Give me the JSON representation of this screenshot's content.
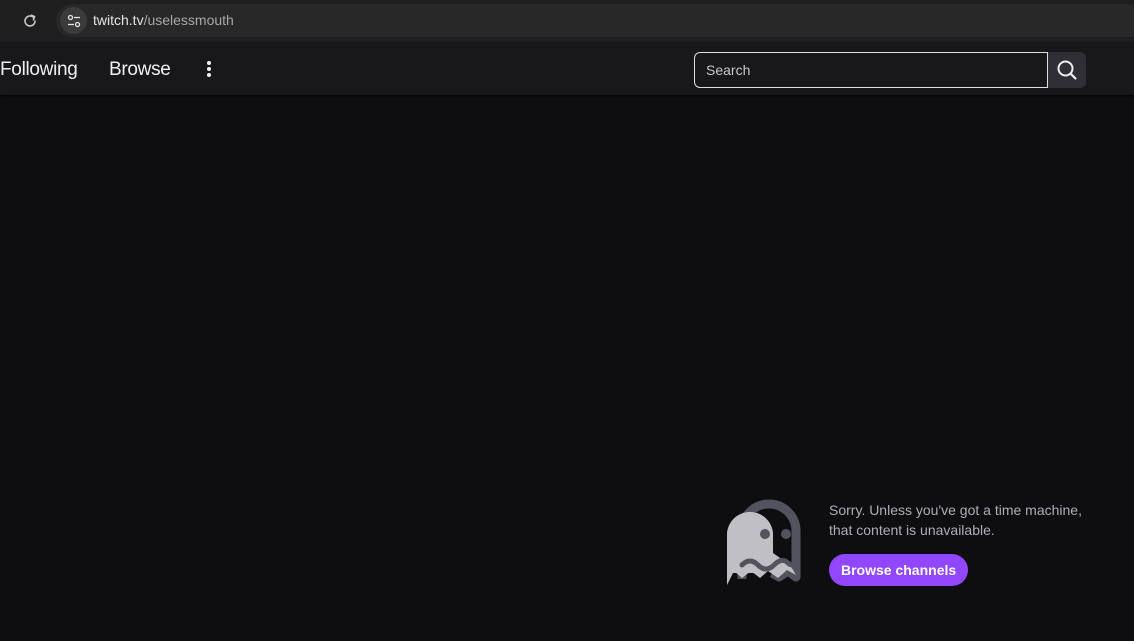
{
  "browser": {
    "url_host": "twitch.tv",
    "url_path": "/uselessmouth"
  },
  "nav": {
    "following_label": "Following",
    "browse_label": "Browse"
  },
  "search": {
    "placeholder": "Search"
  },
  "content": {
    "message_line1": "Sorry. Unless you've got a time machine,",
    "message_line2": "that content is unavailable.",
    "browse_channels_label": "Browse channels"
  },
  "colors": {
    "background": "#0e0e10",
    "topnav": "#18181b",
    "accent": "#9147ff",
    "muted_text": "#adadb8"
  },
  "icons": {
    "reload": "reload-icon",
    "site_info": "tune-icon",
    "more": "more-vertical-icon",
    "search": "search-icon",
    "ghost": "ghost-icon"
  }
}
